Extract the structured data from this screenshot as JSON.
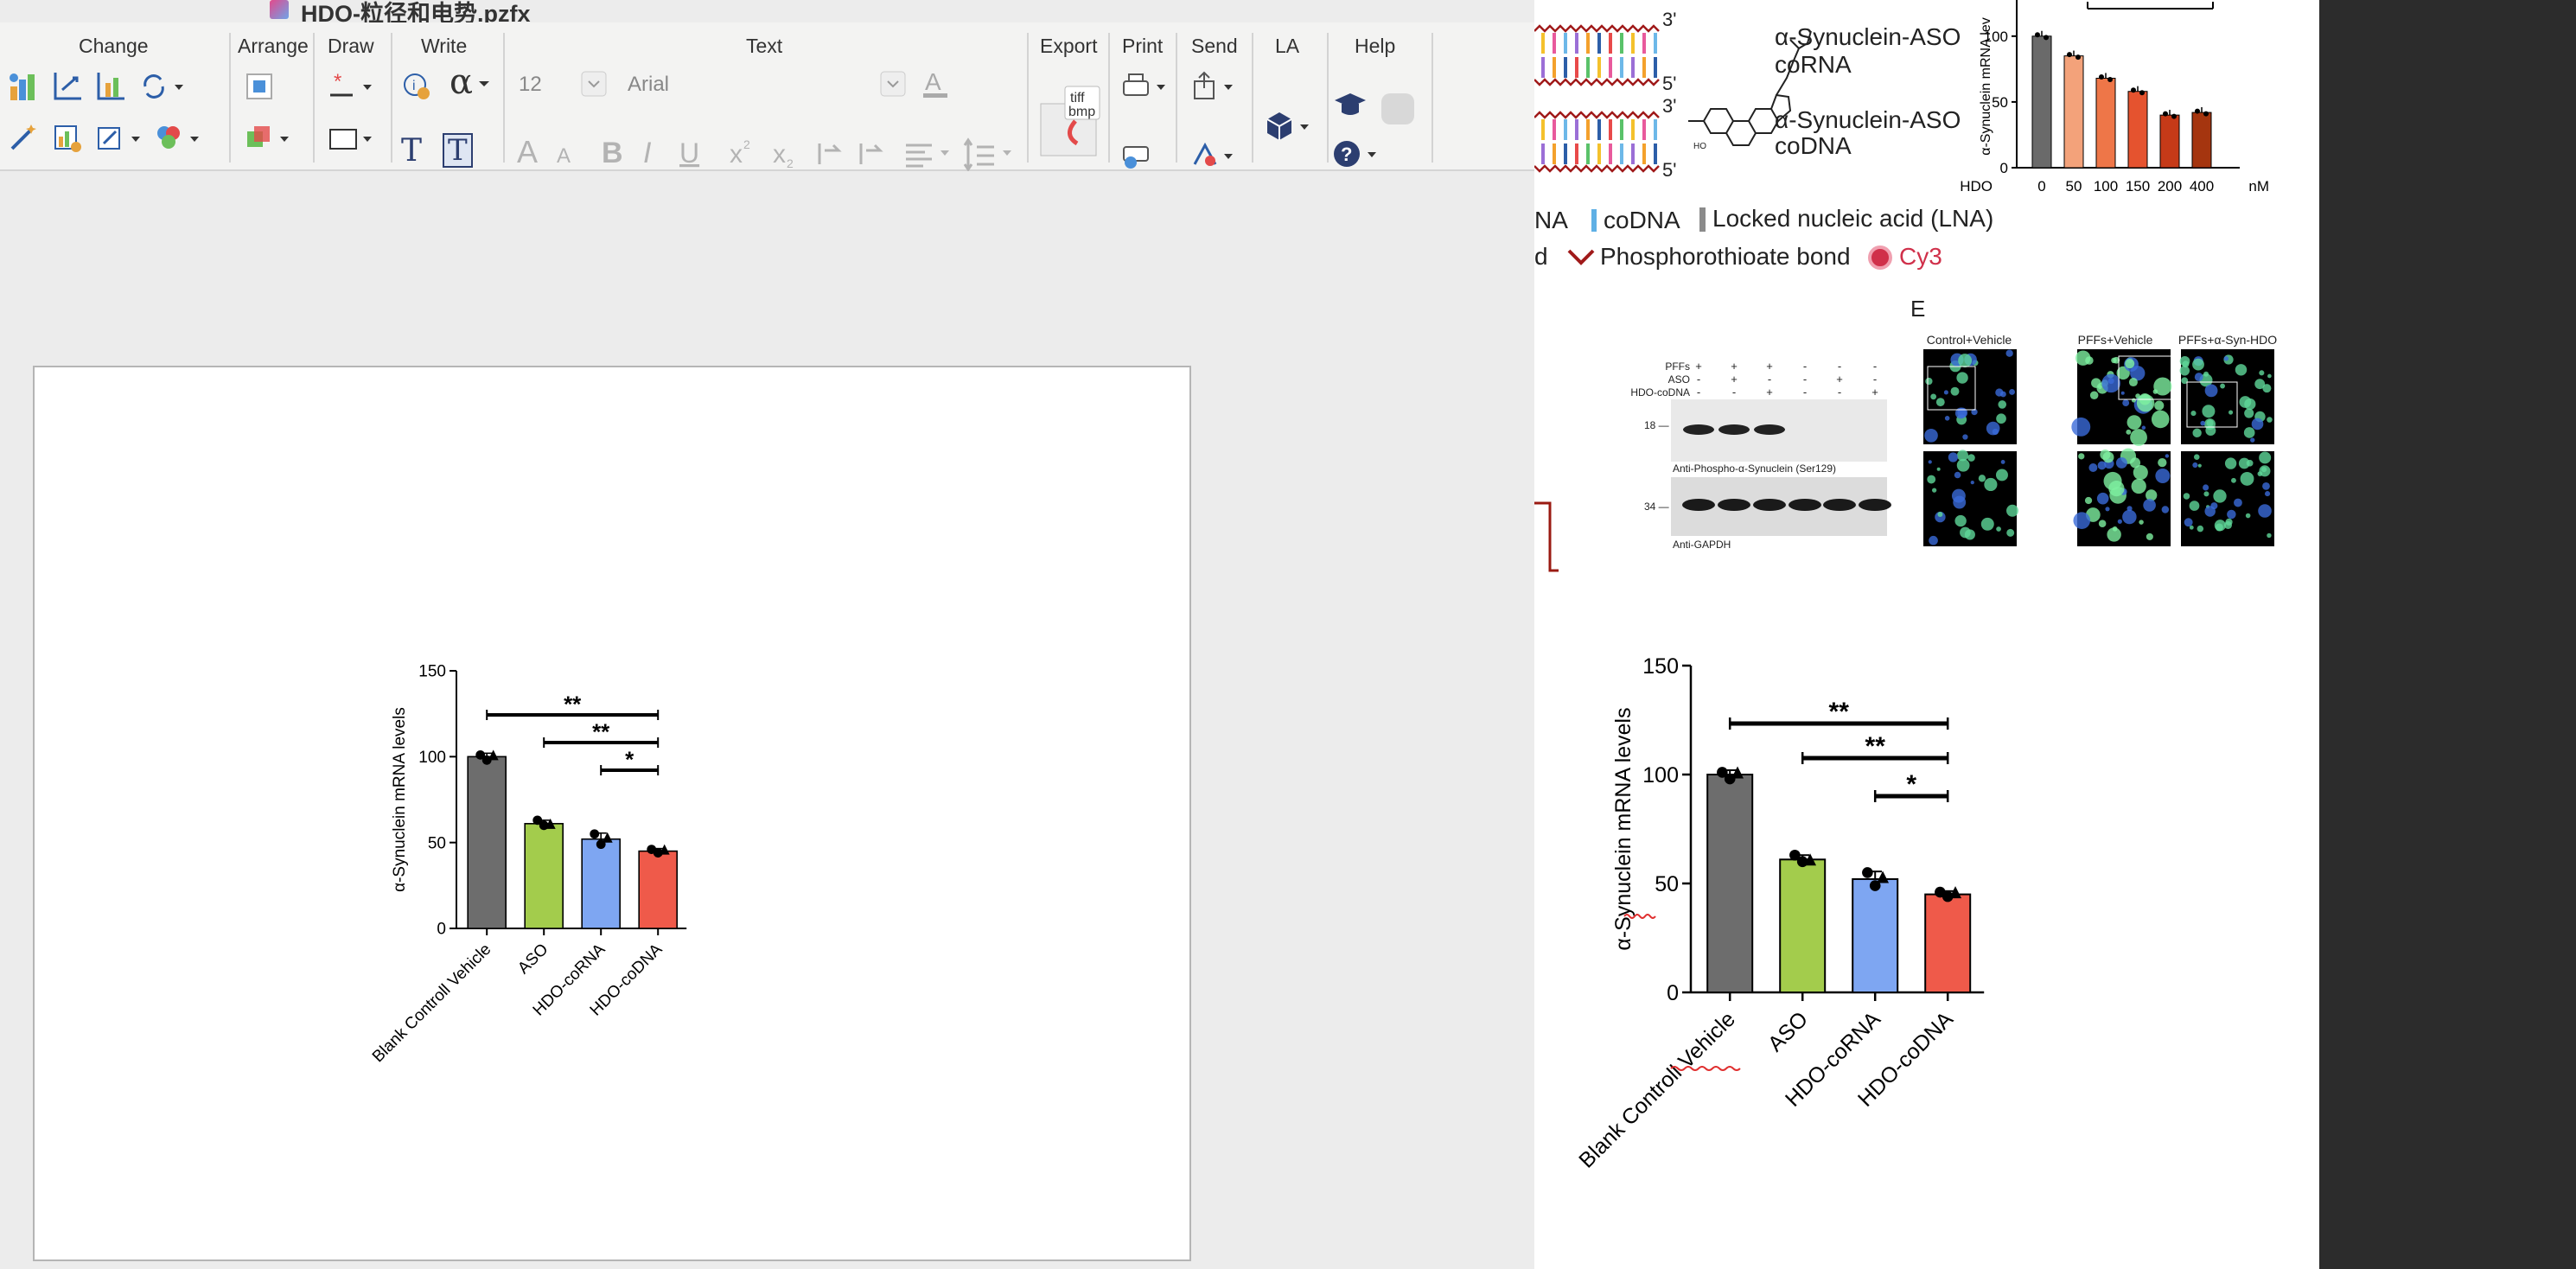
{
  "window": {
    "file_title": "HDO-粒径和电势.pzfx"
  },
  "toolbar": {
    "groups": [
      "Change",
      "Arrange",
      "Draw",
      "Write",
      "Text",
      "Export",
      "Print",
      "Send",
      "LA",
      "Help"
    ],
    "font_size": "12",
    "font_name": "Arial",
    "export_icon_text": "tiff bmp",
    "alpha_glyph": "α",
    "text_glyph": "T"
  },
  "prism_chart": {
    "chart_data": {
      "type": "bar",
      "categories": [
        "Blank Controll Vehicle",
        "ASO",
        "HDO-coRNA",
        "HDO-coDNA"
      ],
      "values": [
        100,
        61,
        52,
        45
      ],
      "points": [
        [
          101,
          98,
          101
        ],
        [
          63,
          60,
          61
        ],
        [
          55,
          49,
          53
        ],
        [
          46,
          44,
          46
        ]
      ],
      "errors": [
        2,
        2,
        3.5,
        1.5
      ],
      "ylabel": "α-Synuclein mRNA levels",
      "xlabel": "",
      "ylim": [
        0,
        150
      ],
      "yticks": [
        "0",
        "50",
        "100",
        "150"
      ],
      "colors": [
        "#6d6d6d",
        "#a3cc4c",
        "#7ea6f2",
        "#ef5a4a"
      ],
      "significance": [
        {
          "from": 0,
          "to": 3,
          "label": "**"
        },
        {
          "from": 1,
          "to": 3,
          "label": "**"
        },
        {
          "from": 2,
          "to": 3,
          "label": "*"
        }
      ],
      "grid": false
    }
  },
  "paper": {
    "duplex": {
      "strand_end_labels": [
        "3'",
        "5'",
        "3'",
        "5'"
      ],
      "aso_corna": "α-Synuclein-ASO\ncoRNA",
      "aso_codna": "α-Synuclein-ASO\ncoDNA",
      "ho": "HO"
    },
    "legend": {
      "rna_partial": "NA",
      "codna": "coDNA",
      "lna": "Locked nucleic acid (LNA)",
      "d_partial": "d",
      "pto": "Phosphorothioate bond",
      "cy3": "Cy3",
      "colors": {
        "codna": "#5fb0e5",
        "lna": "#8b8b8b",
        "pto": "#a01a1a",
        "cy3": "#d0304a"
      }
    },
    "top_bar_chart": {
      "chart_data": {
        "type": "bar",
        "categories": [
          "0",
          "50",
          "100",
          "150",
          "200",
          "400"
        ],
        "values": [
          100,
          85,
          68,
          58,
          40,
          42
        ],
        "ylabel": "α-Synuclein mRNA lev",
        "xlabel_prefix": "HDO",
        "xlabel_unit": "nM",
        "yticks": [
          "0",
          "50",
          "100"
        ],
        "ylim": [
          0,
          115
        ],
        "colors": [
          "#6a6a6a",
          "#f3a27a",
          "#ee7648",
          "#e5532f",
          "#c63a18",
          "#a5350f"
        ]
      }
    },
    "panel_e_label": "E",
    "western": {
      "rows": [
        "PFFs",
        "ASO",
        "HDO-coDNA"
      ],
      "signs": [
        [
          "+",
          "+",
          "+",
          "-",
          "-",
          "-"
        ],
        [
          "-",
          "+",
          "-",
          "-",
          "+",
          "-"
        ],
        [
          "-",
          "-",
          "+",
          "-",
          "-",
          "+"
        ]
      ],
      "marker_18": "18 —",
      "marker_34": "34 —",
      "caption_1": "Anti-Phospho-α-Synuclein (Ser129)",
      "caption_2": "Anti-GAPDH"
    },
    "micrographs": {
      "titles": [
        "Control+Vehicle",
        "PFFs+Vehicle",
        "PFFs+α-Syn-HDO"
      ]
    },
    "bottom_chart": {
      "chart_data": {
        "type": "bar",
        "categories": [
          "Blank Controll Vehicle",
          "ASO",
          "HDO-coRNA",
          "HDO-coDNA"
        ],
        "values": [
          100,
          61,
          52,
          45
        ],
        "ylabel": "α-Synuclein mRNA levels",
        "ylim": [
          0,
          150
        ],
        "yticks": [
          "0",
          "50",
          "100",
          "150"
        ],
        "colors": [
          "#6d6d6d",
          "#a3cc4c",
          "#7ea6f2",
          "#ef5a4a"
        ],
        "significance": [
          {
            "from": 0,
            "to": 3,
            "label": "**"
          },
          {
            "from": 1,
            "to": 3,
            "label": "**"
          },
          {
            "from": 2,
            "to": 3,
            "label": "*"
          }
        ]
      }
    }
  }
}
